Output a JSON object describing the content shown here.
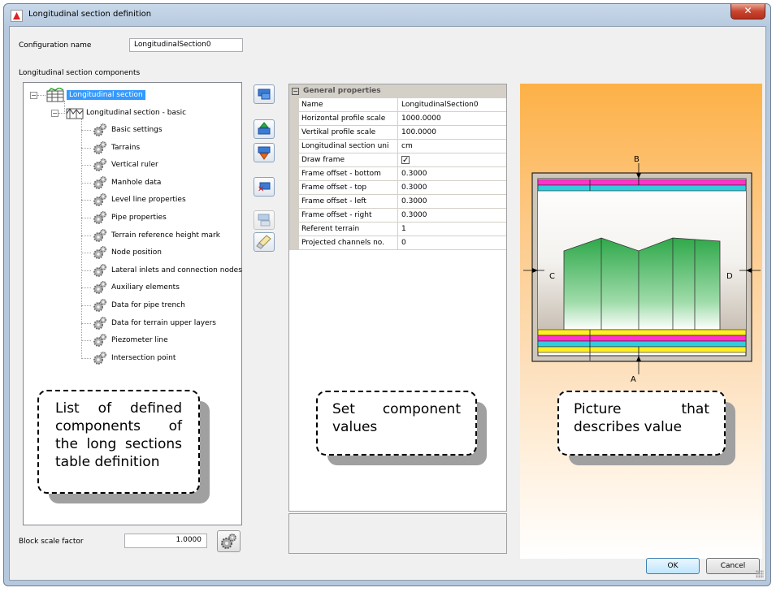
{
  "window": {
    "title": "Longitudinal section definition",
    "close_glyph": "✕"
  },
  "config": {
    "name_label": "Configuration name",
    "name_value": "LongitudinalSection0",
    "components_label": "Longitudinal section components"
  },
  "tree": {
    "root": "Longitudinal section",
    "child": "Longitudinal section - basic",
    "items": [
      "Basic settings",
      "Tarrains",
      "Vertical ruler",
      "Manhole data",
      "Level line properties",
      "Pipe properties",
      "Terrain reference height mark",
      "Node position",
      "Lateral inlets and connection nodes",
      "Auxiliary elements",
      "Data for pipe trench",
      "Data for terrain upper layers",
      "Piezometer line",
      "Intersection point"
    ]
  },
  "toolbar": {
    "icons": [
      "add-section-icon",
      "move-up-icon",
      "move-down-icon",
      "delete-icon",
      "add-component-icon",
      "clear-icon"
    ]
  },
  "properties": {
    "category": "General properties",
    "rows": [
      {
        "name": "Name",
        "value": "LongitudinalSection0"
      },
      {
        "name": "Horizontal profile scale",
        "value": "1000.0000"
      },
      {
        "name": "Vertikal profile scale",
        "value": "100.0000"
      },
      {
        "name": "Longitudinal section uni",
        "value": "cm"
      },
      {
        "name": "Draw frame",
        "value": "",
        "checked": true
      },
      {
        "name": "Frame offset - bottom",
        "value": "0.3000"
      },
      {
        "name": "Frame offset - top",
        "value": "0.3000"
      },
      {
        "name": "Frame offset - left",
        "value": "0.3000"
      },
      {
        "name": "Frame offset - right",
        "value": "0.3000"
      },
      {
        "name": "Referent terrain",
        "value": "1"
      },
      {
        "name": "Projected channels no.",
        "value": "0"
      }
    ]
  },
  "picture": {
    "label_a": "A",
    "label_b": "B",
    "label_c": "C",
    "label_d": "D"
  },
  "callouts": {
    "tree": "List of defined components of the long sections table definition",
    "values": "Set component values",
    "picture": "Picture that describes value"
  },
  "block_scale": {
    "label": "Block scale factor",
    "value": "1.0000"
  },
  "buttons": {
    "ok": "OK",
    "cancel": "Cancel"
  },
  "colors": {
    "selection": "#3399ff",
    "terrain_green": "#33b34a",
    "band_magenta": "#ff33cc",
    "band_cyan": "#33ccdd",
    "band_yellow": "#ffee22"
  }
}
